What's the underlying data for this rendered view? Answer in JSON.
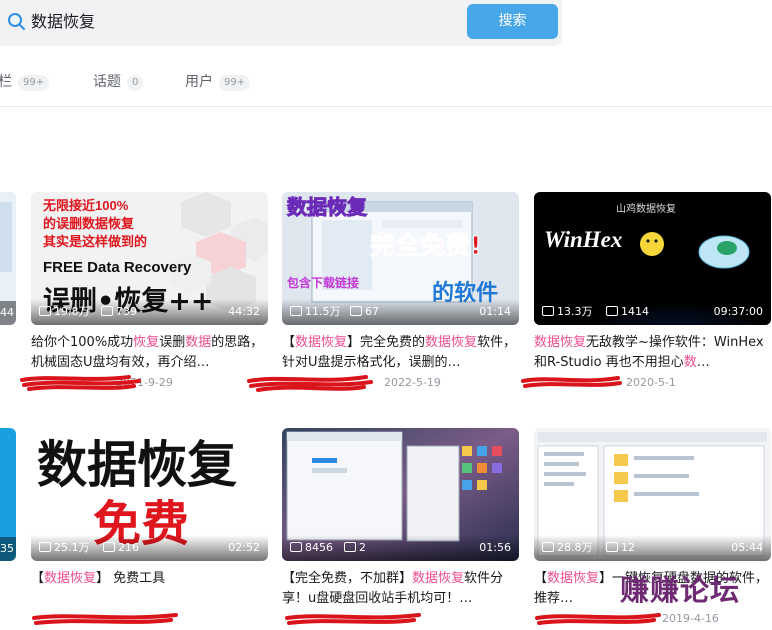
{
  "search": {
    "query": "数据恢复",
    "button_label": "搜索"
  },
  "tabs": [
    {
      "label": "栏",
      "count": "99+"
    },
    {
      "label": "话题",
      "count": "0"
    },
    {
      "label": "用户",
      "count": "99+"
    }
  ],
  "cards": [
    {
      "views": "19.8万",
      "danmaku": "739",
      "duration": "44:32",
      "title_html": "给你个100%成功<span class=\"hl\">恢复</span>误删<span class=\"hl\">数据</span>的思路，机械固态U盘均有效，再介绍…",
      "date": "2021-9-29",
      "thumb_lines": [
        "无限接近100%",
        "的误删数据恢复",
        "其实是这样做到的",
        "FREE Data Recovery",
        "误删•恢复++"
      ]
    },
    {
      "views": "11.5万",
      "danmaku": "67",
      "duration": "01:14",
      "title_html": "【<span class=\"hl\">数据恢复</span>】完全免费的<span class=\"hl\">数据恢复</span>软件，针对U盘提示格式化，误删的…",
      "date": "2022-5-19",
      "thumb_lines": [
        "数据恢复",
        "完全免费!",
        "包含下载链接",
        "的软件"
      ]
    },
    {
      "views": "13.3万",
      "danmaku": "1414",
      "duration": "09:37:00",
      "title_html": "<span class=\"hl\">数据恢复</span>无敌教学~操作软件：WinHex和R-Studio 再也不用担心<span class=\"hl\">数</span>…",
      "date": "2020-5-1",
      "thumb_lines": [
        "山鸡数据恢复",
        "WinHex"
      ]
    },
    {
      "views": "25.1万",
      "danmaku": "216",
      "duration": "02:52",
      "title_html": "【<span class=\"hl\">数据恢复</span>】 免费工具",
      "date": "",
      "thumb_lines": [
        "数据恢复",
        "免费"
      ]
    },
    {
      "views": "8456",
      "danmaku": "2",
      "duration": "01:56",
      "title_html": "【完全免费，不加群】<span class=\"hl\">数据恢复</span>软件分享！u盘硬盘回收站手机均可！…",
      "date": "",
      "thumb_lines": []
    },
    {
      "views": "28.8万",
      "danmaku": "12",
      "duration": "05:44",
      "title_html": "【<span class=\"hl\">数据恢复</span>】一键恢复硬盘数据的软件，推荐…",
      "date": "2019-4-16",
      "thumb_lines": []
    }
  ],
  "left_edge_durations": [
    "44",
    "35"
  ],
  "watermark": "赚赚论坛",
  "colors": {
    "accent": "#47a7e8",
    "highlight": "#ec4d8f",
    "scribble": "#d9141b"
  }
}
